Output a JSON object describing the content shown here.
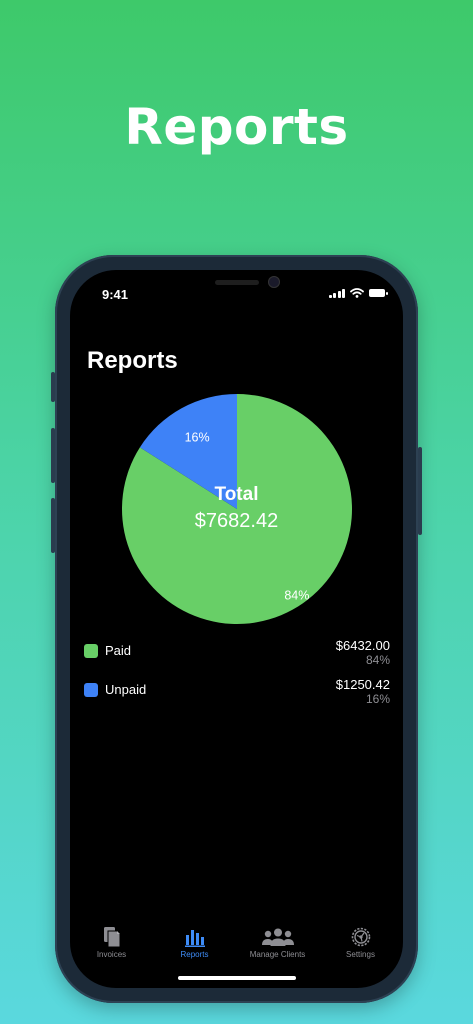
{
  "hero": {
    "title": "Reports"
  },
  "status_bar": {
    "time": "9:41"
  },
  "screen": {
    "title": "Reports"
  },
  "colors": {
    "paid": "#68cf67",
    "unpaid": "#3e82f7",
    "accent": "#3e8cf7",
    "inactive": "#8e8e93"
  },
  "chart_data": {
    "type": "pie",
    "slices": [
      {
        "label": "Paid",
        "value": 84,
        "display": "84%",
        "color": "#68cf67"
      },
      {
        "label": "Unpaid",
        "value": 16,
        "display": "16%",
        "color": "#3e82f7"
      }
    ],
    "center_label": "Total",
    "center_value": "$7682.42"
  },
  "legend": [
    {
      "name": "Paid",
      "amount": "$6432.00",
      "percent": "84%"
    },
    {
      "name": "Unpaid",
      "amount": "$1250.42",
      "percent": "16%"
    }
  ],
  "tabs": [
    {
      "label": "Invoices",
      "icon": "document-icon",
      "active": false
    },
    {
      "label": "Reports",
      "icon": "bar-chart-icon",
      "active": true
    },
    {
      "label": "Manage Clients",
      "icon": "people-icon",
      "active": false
    },
    {
      "label": "Settings",
      "icon": "gear-icon",
      "active": false
    }
  ]
}
